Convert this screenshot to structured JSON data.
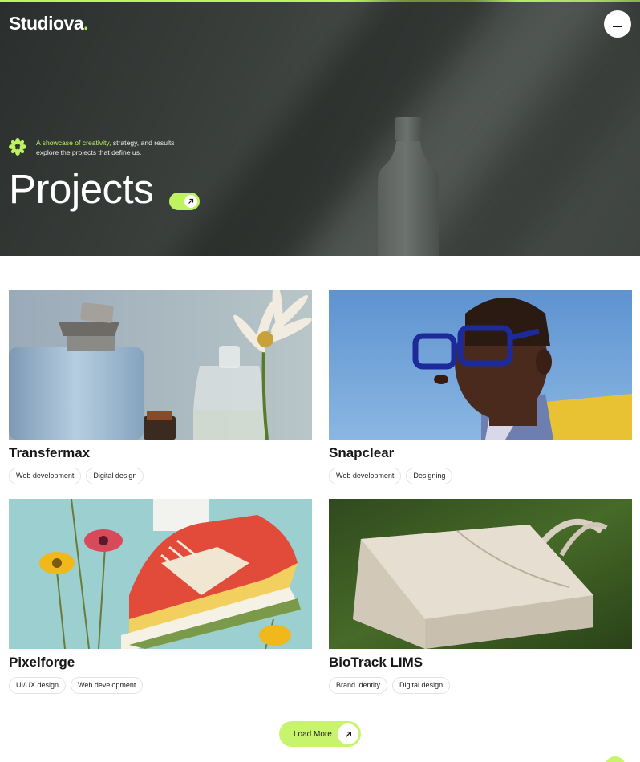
{
  "brand": {
    "name": "Studiova",
    "dot": ".",
    "accent": "#bdf35e"
  },
  "hero": {
    "tagline_highlight": "A showcase of creativity,",
    "tagline_rest": " strategy, and results explore the projects that define us.",
    "title": "Projects"
  },
  "projects": [
    {
      "title": "Transfermax",
      "tags": [
        "Web development",
        "Digital design"
      ],
      "image": "perfume bottles with daisy"
    },
    {
      "title": "Snapclear",
      "tags": [
        "Web development",
        "Designing"
      ],
      "image": "portrait with blue glasses"
    },
    {
      "title": "Pixelforge",
      "tags": [
        "UI/UX design",
        "Web development"
      ],
      "image": "sneaker with wildflowers"
    },
    {
      "title": "BioTrack LIMS",
      "tags": [
        "Brand identity",
        "Digital design"
      ],
      "image": "tote bag on grass"
    }
  ],
  "load_more": {
    "label": "Load More"
  },
  "icons": {
    "menu": "hamburger-icon",
    "arrow": "arrow-up-right-icon",
    "asterisk": "asterisk-icon"
  }
}
